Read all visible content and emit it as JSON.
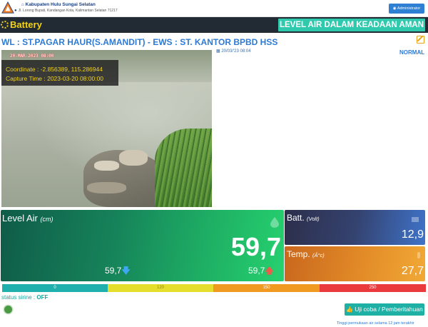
{
  "header": {
    "org_name": "Kabupaten Hulu Sungai Selatan",
    "address": "Jl. Lorong Bupati, Kandangan Kota, Kalimantan Selatan 71217",
    "admin_label": "Administrator"
  },
  "topbar": {
    "battery_label": "Battery",
    "status_title": "LEVEL AIR DALAM KEADAAN AMAN"
  },
  "station": {
    "title": "WL : ST.PAGAR HAUR(S.AMANDIT) - EWS : ST. KANTOR BPBD HSS",
    "timestamp": "20/03/'23 08:04",
    "status": "NORMAL"
  },
  "camera": {
    "overlay_date": "20-MAR-2023 08:00",
    "coordinate": "Coordinate : -2.856389, 115.286944",
    "capture_time": "Capture Time : 2023-03-20 08:00:00"
  },
  "level": {
    "label": "Level Air",
    "unit": "(cm)",
    "value": "59,7",
    "min": "59,7",
    "max": "59,7"
  },
  "battery": {
    "label": "Batt.",
    "unit": "(Volt)",
    "value": "12,9"
  },
  "temperature": {
    "label": "Temp.",
    "unit": "(Â°c)",
    "value": "27,7"
  },
  "thresholds": [
    {
      "label": "0",
      "color": "#1fb0ad"
    },
    {
      "label": "120",
      "color": "#e6de2c"
    },
    {
      "label": "150",
      "color": "#f09a22"
    },
    {
      "label": "250",
      "color": "#ea3a3d"
    }
  ],
  "siren": {
    "label": "status sirine : ",
    "status": "OFF"
  },
  "test_button": "Uji coba / Pemberitahuan",
  "footnote": "Tinggi permukaan air selama 12 jam terakhir"
}
